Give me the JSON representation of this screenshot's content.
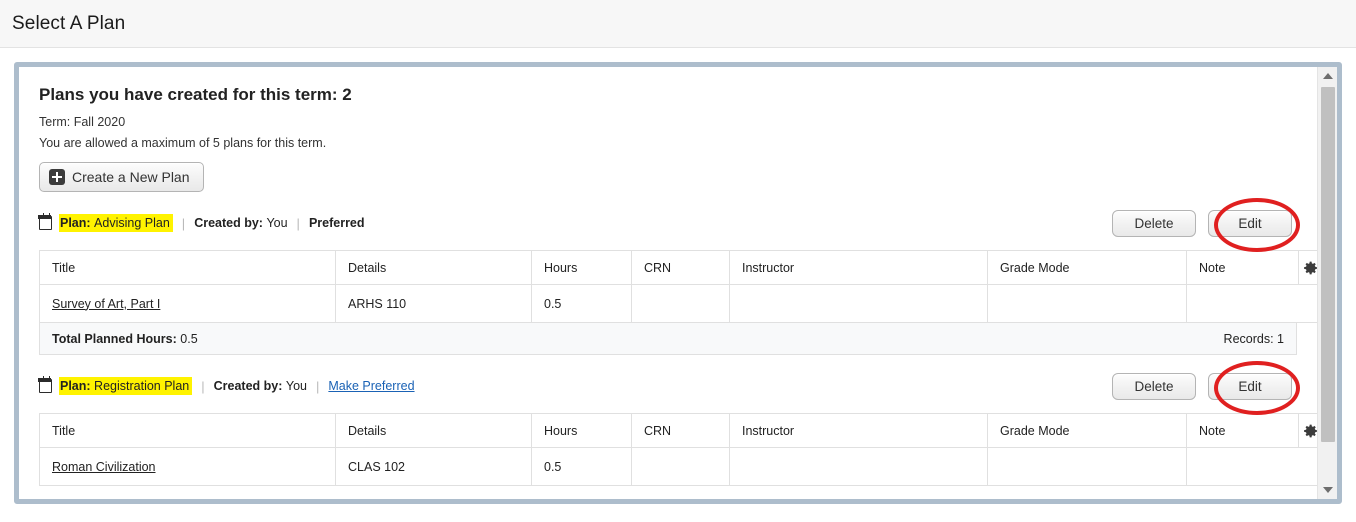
{
  "header": {
    "title": "Select A Plan"
  },
  "panel": {
    "heading": "Plans you have created for this term: 2",
    "term_line": "Term: Fall 2020",
    "max_line": "You are allowed a maximum of 5 plans for this term.",
    "create_button": "Create a New Plan",
    "create_icon": "plus-square-icon"
  },
  "table_headers": {
    "title": "Title",
    "details": "Details",
    "hours": "Hours",
    "crn": "CRN",
    "instructor": "Instructor",
    "grade_mode": "Grade Mode",
    "note": "Note",
    "settings_icon": "gear-icon"
  },
  "plans": [
    {
      "plan_label": "Plan:",
      "plan_name": "Advising Plan",
      "created_by_label": "Created by:",
      "created_by_value": "You",
      "status": "Preferred",
      "status_is_link": false,
      "calendar_icon": "calendar-icon",
      "delete_button": "Delete",
      "edit_button": "Edit",
      "edit_highlighted": true,
      "rows": [
        {
          "title": "Survey of Art, Part I",
          "details": "ARHS 110",
          "hours": "0.5",
          "crn": "",
          "instructor": "",
          "grade_mode": "",
          "note": ""
        }
      ],
      "totals": {
        "label": "Total Planned Hours:",
        "value": "0.5",
        "records": "Records: 1"
      },
      "show_totals": true
    },
    {
      "plan_label": "Plan:",
      "plan_name": "Registration Plan",
      "created_by_label": "Created by:",
      "created_by_value": "You",
      "status": "Make Preferred",
      "status_is_link": true,
      "calendar_icon": "calendar-icon",
      "delete_button": "Delete",
      "edit_button": "Edit",
      "edit_highlighted": true,
      "rows": [
        {
          "title": "Roman Civilization",
          "details": "CLAS 102",
          "hours": "0.5",
          "crn": "",
          "instructor": "",
          "grade_mode": "",
          "note": ""
        }
      ],
      "show_totals": false
    }
  ],
  "scrollbar": {
    "up_icon": "triangle-up-icon",
    "down_icon": "triangle-down-icon"
  },
  "colors": {
    "highlight": "#fff300",
    "annotation": "#e02020",
    "link": "#1a62b5",
    "panel_border": "#adbdcc"
  }
}
